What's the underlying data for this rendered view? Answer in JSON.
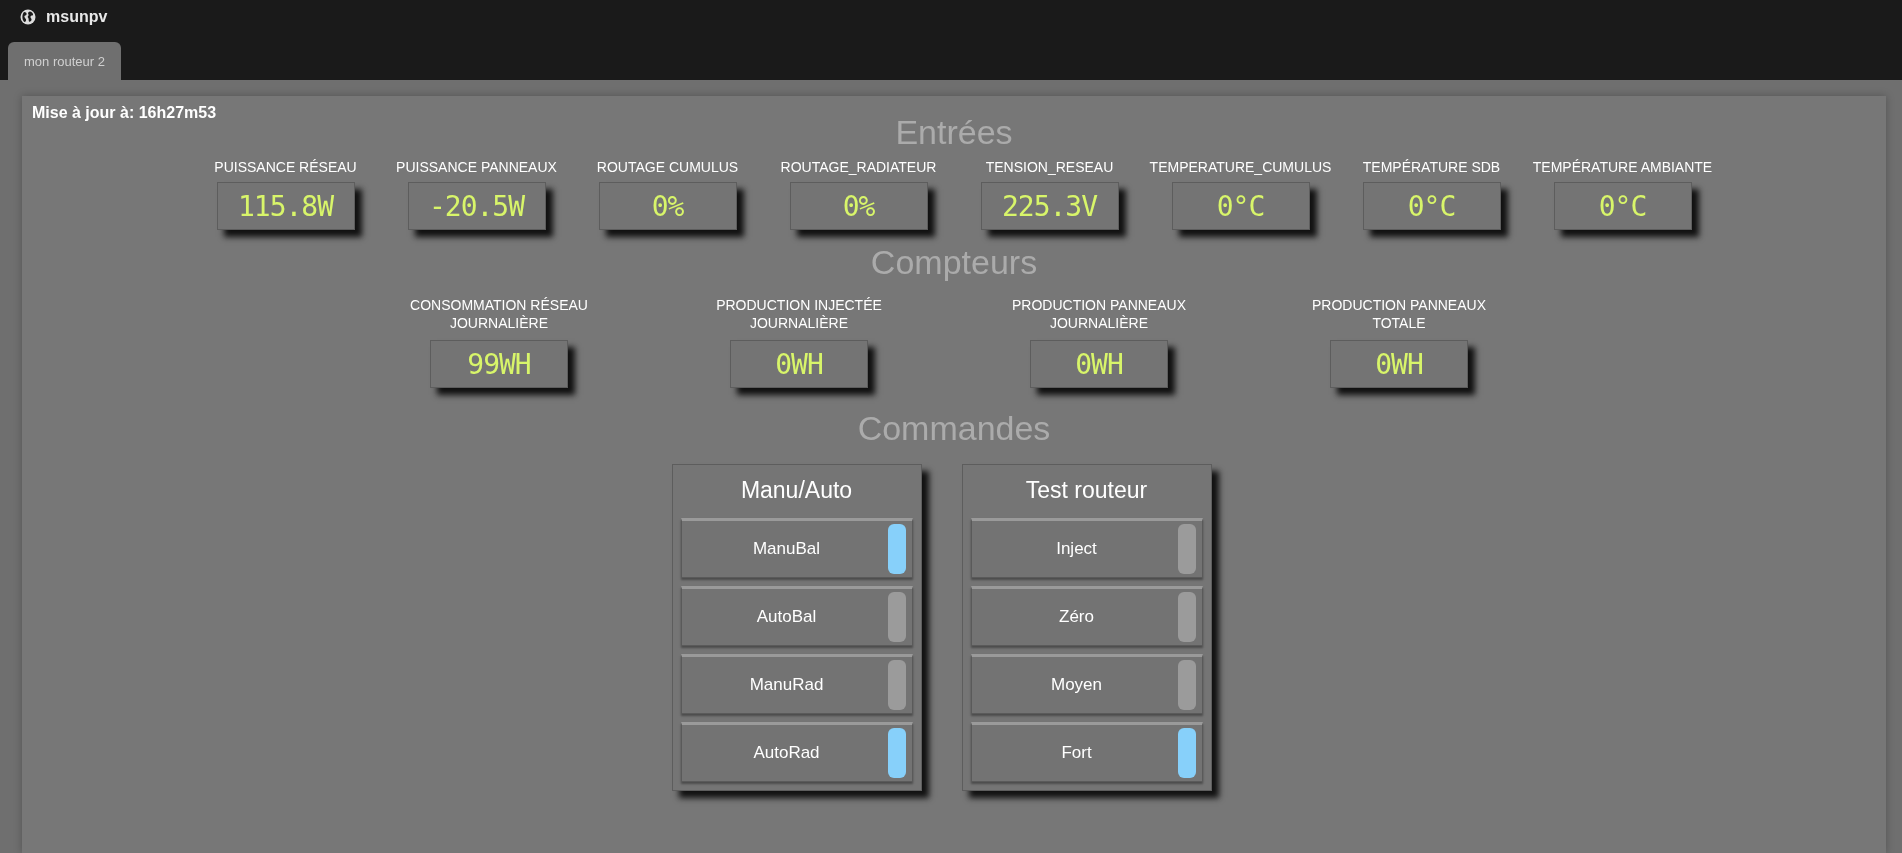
{
  "app": {
    "title": "msunpv"
  },
  "tabs": [
    {
      "label": "mon routeur 2",
      "selected": true
    }
  ],
  "updated": "Mise à jour à: 16h27m53",
  "inputs": {
    "title": "Entrées",
    "gauges": [
      {
        "label": "PUISSANCE RÉSEAU",
        "value": "115.8W"
      },
      {
        "label": "PUISSANCE PANNEAUX",
        "value": "-20.5W"
      },
      {
        "label": "ROUTAGE CUMULUS",
        "value": "0%"
      },
      {
        "label": "ROUTAGE_RADIATEUR",
        "value": "0%"
      },
      {
        "label": "TENSION_RESEAU",
        "value": "225.3V"
      },
      {
        "label": "TEMPERATURE_CUMULUS",
        "value": "0°C"
      },
      {
        "label": "TEMPÉRATURE SDB",
        "value": "0°C"
      },
      {
        "label": "TEMPÉRATURE AMBIANTE",
        "value": "0°C"
      }
    ]
  },
  "counters": {
    "title": "Compteurs",
    "gauges": [
      {
        "label": "CONSOMMATION RÉSEAU JOURNALIÈRE",
        "value": "99WH"
      },
      {
        "label": "PRODUCTION INJECTÉE JOURNALIÈRE",
        "value": "0WH"
      },
      {
        "label": "PRODUCTION PANNEAUX JOURNALIÈRE",
        "value": "0WH"
      },
      {
        "label": "PRODUCTION PANNEAUX TOTALE",
        "value": "0WH"
      }
    ]
  },
  "commands": {
    "title": "Commandes",
    "groups": [
      {
        "title": "Manu/Auto",
        "buttons": [
          {
            "label": "ManuBal",
            "on": true
          },
          {
            "label": "AutoBal",
            "on": false
          },
          {
            "label": "ManuRad",
            "on": false
          },
          {
            "label": "AutoRad",
            "on": true
          }
        ]
      },
      {
        "title": "Test routeur",
        "buttons": [
          {
            "label": "Inject",
            "on": false
          },
          {
            "label": "Zéro",
            "on": false
          },
          {
            "label": "Moyen",
            "on": false
          },
          {
            "label": "Fort",
            "on": true
          }
        ]
      }
    ]
  }
}
